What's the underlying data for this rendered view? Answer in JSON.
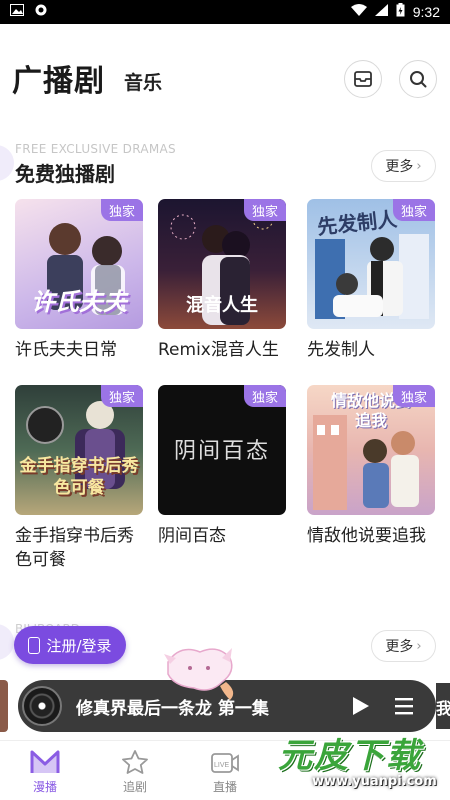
{
  "status_bar": {
    "time": "9:32"
  },
  "header": {
    "title": "广播剧",
    "subtitle": "音乐"
  },
  "section1": {
    "en_label": "FREE EXCLUSIVE DRAMAS",
    "title": "免费独播剧",
    "more_label": "更多"
  },
  "cards": [
    {
      "title": "许氏夫夫日常",
      "badge": "独家",
      "cover_text": "许氏夫夫",
      "colors": [
        "#f3d9e6",
        "#c9b6e8"
      ]
    },
    {
      "title": "Remix混音人生",
      "badge": "独家",
      "cover_text": "混音人生",
      "colors": [
        "#2b1d3d",
        "#7a3b45"
      ]
    },
    {
      "title": "先发制人",
      "badge": "独家",
      "cover_text": "先发制人",
      "colors": [
        "#a9c7e8",
        "#e9eef6"
      ]
    },
    {
      "title": "金手指穿书后秀色可餐",
      "badge": "独家",
      "cover_text": "金手指穿书后秀色可餐",
      "colors": [
        "#3f5a4b",
        "#c6b98a"
      ]
    },
    {
      "title": "阴间百态",
      "badge": "独家",
      "cover_text": "阴间百态",
      "colors": [
        "#0d0d0d",
        "#1c1c1c"
      ]
    },
    {
      "title": "情敌他说要追我",
      "badge": "独家",
      "cover_text": "情敌他说要追我",
      "colors": [
        "#f5c9b5",
        "#d9a9c9"
      ]
    }
  ],
  "section2": {
    "en_label": "BILIBOARD",
    "more_label": "更多",
    "login_label": "注册/登录"
  },
  "player": {
    "title": "修真界最后一条龙 第一集",
    "peek_right_text": "我"
  },
  "bottom_nav": [
    {
      "label": "漫播",
      "active": true
    },
    {
      "label": "追剧",
      "active": false
    },
    {
      "label": "直播",
      "active": false
    }
  ],
  "watermark": {
    "text": "元皮下载",
    "url": "www.yuanpi.com"
  },
  "colors": {
    "accent": "#8b5de4",
    "badge": "#9b74e6",
    "player_bg": "#3a3a3a"
  }
}
